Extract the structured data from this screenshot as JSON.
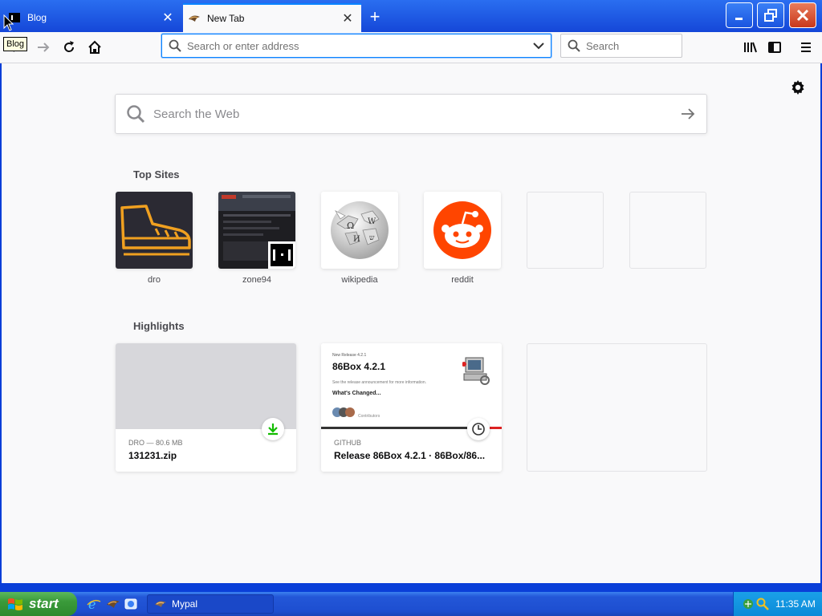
{
  "tabs": [
    {
      "title": "Blog",
      "active": false
    },
    {
      "title": "New Tab",
      "active": true
    }
  ],
  "tooltip": "Blog",
  "urlbar": {
    "placeholder": "Search or enter address"
  },
  "searchbar": {
    "placeholder": "Search"
  },
  "newtab": {
    "web_search_placeholder": "Search the Web",
    "top_sites_title": "Top Sites",
    "top_sites": [
      {
        "label": "dro",
        "icon": "boot-icon"
      },
      {
        "label": "zone94",
        "icon": "zone94-thumbnail"
      },
      {
        "label": "wikipedia",
        "icon": "wikipedia-globe-icon"
      },
      {
        "label": "reddit",
        "icon": "reddit-alien-icon"
      },
      {
        "label": "",
        "icon": "empty"
      },
      {
        "label": "",
        "icon": "empty"
      }
    ],
    "highlights_title": "Highlights",
    "highlights": [
      {
        "context": "DRO — 80.6 MB",
        "title": "131231.zip",
        "badge": "download-icon"
      },
      {
        "context": "GITHUB",
        "title": "Release 86Box 4.2.1 · 86Box/86...",
        "badge": "clock-icon",
        "preview": {
          "small_top": "New Release 4.2.1",
          "heading": "86Box 4.2.1",
          "line": "See the release announcement for more information.",
          "subheading": "What's Changed...",
          "footer": "Contributors"
        }
      }
    ]
  },
  "taskbar": {
    "start_label": "start",
    "task_label": "Mypal",
    "clock": "11:35 AM"
  },
  "colors": {
    "accent": "#0a84ff",
    "reddit": "#ff4500",
    "dro_tile_bg": "#2b2a33",
    "dro_boot": "#f0a020",
    "download_green": "#12bc00"
  }
}
